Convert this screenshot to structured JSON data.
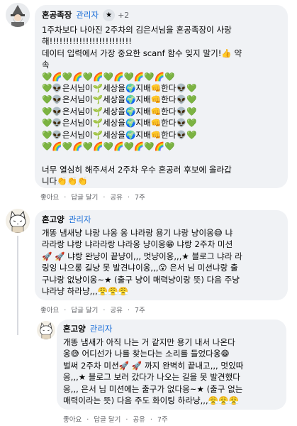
{
  "post1": {
    "author": "혼공족장",
    "role_badge": "관리자",
    "star_icon": "★",
    "plus_count": "+2",
    "lines": [
      "1주차보다 나아진 2주차의 김은서님을 혼공족장이 사랑",
      "해!!!!!!!!!!!!!!!!!!!!!!!!!",
      "데이터 입력에서 가장 중요한 scanf 함수 잊지 말기!👍 약",
      "속",
      "💚🌈💚🌈💚🌈💚🌈💚🌈💚🌈💚",
      "💚👽은서님이🌱세상을🌍지배👊한다👽💚",
      "💚👽은서님이🌱세상을🌍지배👊한다👽💚",
      "💚👽은서님이🌱세상을🌍지배👊한다👽💚",
      "💚👽은서님이🌱세상을🌍지배👊한다👽💚",
      "💚👽은서님이🌱세상을🌍지배👊한다👽💚",
      "💚🌈💚🌈💚🌈💚🌈💚🌈💚🌈💚",
      "",
      "너무 열심히 해주셔서 2주차 우수 혼공러 후보에 올라갑",
      "니다👏👏👏"
    ],
    "actions": {
      "like": "좋아요",
      "reply": "답글 달기",
      "share": "공유",
      "time": "7주",
      "sep": "·"
    }
  },
  "post2": {
    "author": "혼고양",
    "role_badge": "관리자",
    "lines": [
      "개똥 냄새냥 냐랑 냐옹 옹 냐라랑 용기 냐랑 냥이옹😅 냐",
      "라라랑 냐랑 냐라라랑 냐라옹 냥이옹😁 냐랑 2주차 미션",
      "🚀 🚀 냐랑 완냥이 끝냥이,,, 멋냥이옹,,,★ 블로그 냐라 라",
      "링잉 냐으롱 길냥 못 발견냐이옹,,,😮 은서 님 미션냐랑 출",
      "구냐랑 없냥이옹~★ (출구 냥이 매력냥이랑 뜻) 다음 주냥",
      "냐라냥 하라냥,,,😤😤😤"
    ],
    "actions": {
      "like": "좋아요",
      "reply": "답글 달기",
      "share": "공유",
      "time": "7주",
      "sep": "·"
    }
  },
  "reply": {
    "author": "혼고양",
    "role_badge": "관리자",
    "lines": [
      "개똥 냄새가 아직 나는 거 같지만 용기 내서 나온다",
      "옹😅 어디선가 나를 찾는다는 소리를 들었다옹😁",
      "벌써 2주차 미션🚀 🚀 까지 완벽히 끝내고,,, 멋있따",
      "옹,,,★ 블로그 보러 갔다가 나오는 길을 못 발견했다",
      "옹,,, 은서 님 미션에는 출구가 없다옹~★ (출구 없는",
      "매력이라는 뜻) 다음 주도 화이팅 하라냥,,,😤😤😤"
    ],
    "actions": {
      "like": "좋아요",
      "reply": "답글 달기",
      "share": "공유",
      "time": "7주",
      "sep": "·"
    }
  },
  "colors": {
    "badge": "#1c6fd8",
    "bubble": "#f0f2f5",
    "meta": "#65676b"
  }
}
